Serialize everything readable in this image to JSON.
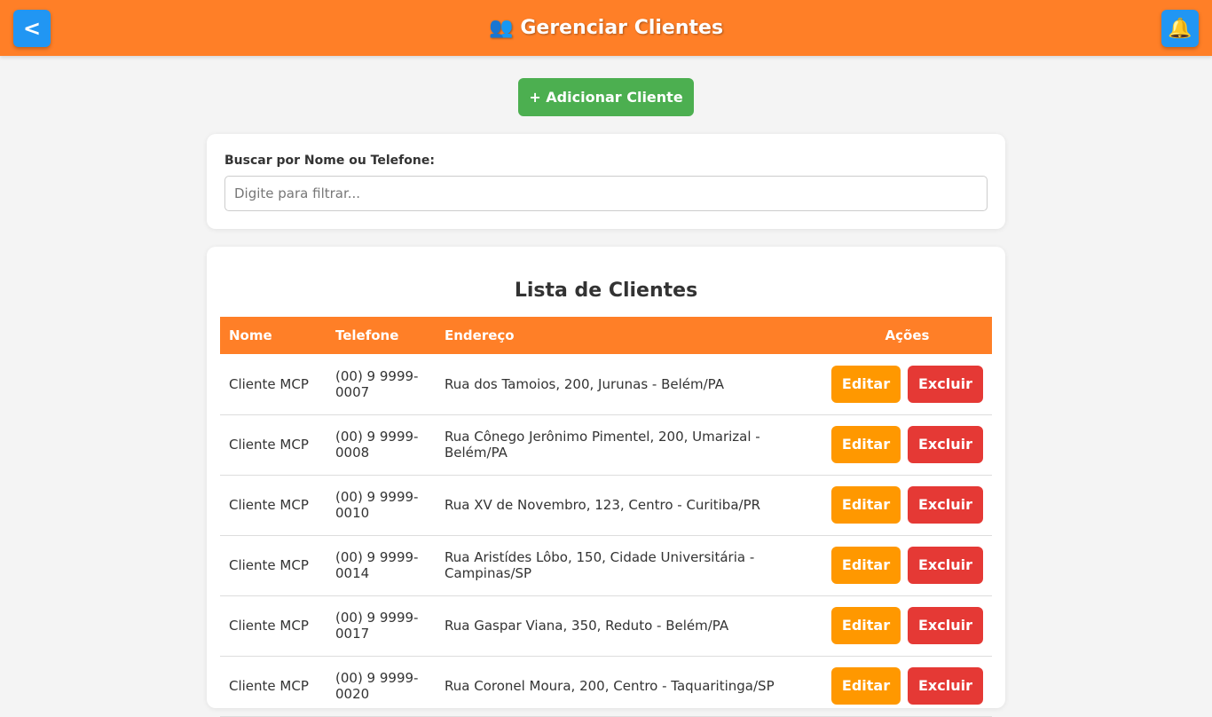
{
  "header": {
    "back_label": "<",
    "title_icon": "👥",
    "title": "Gerenciar Clientes",
    "bell_icon": "🔔",
    "color": "#ff7f27"
  },
  "add_button": {
    "label": "+ Adicionar Cliente",
    "color": "#4caf50"
  },
  "search": {
    "label": "Buscar por Nome ou Telefone:",
    "placeholder": "Digite para filtrar...",
    "value": ""
  },
  "list": {
    "title": "Lista de Clientes",
    "columns": [
      "Nome",
      "Telefone",
      "Endereço",
      "Ações"
    ],
    "edit_label": "Editar",
    "delete_label": "Excluir",
    "rows": [
      {
        "name": "Cliente MCP",
        "phone": "(00) 9 9999-0007",
        "address": "Rua dos Tamoios, 200, Jurunas - Belém/PA"
      },
      {
        "name": "Cliente MCP",
        "phone": "(00) 9 9999-0008",
        "address": "Rua Cônego Jerônimo Pimentel, 200, Umarizal - Belém/PA"
      },
      {
        "name": "Cliente MCP",
        "phone": "(00) 9 9999-0010",
        "address": "Rua XV de Novembro, 123, Centro - Curitiba/PR"
      },
      {
        "name": "Cliente MCP",
        "phone": "(00) 9 9999-0014",
        "address": "Rua Aristídes Lôbo, 150, Cidade Universitária - Campinas/SP"
      },
      {
        "name": "Cliente MCP",
        "phone": "(00) 9 9999-0017",
        "address": "Rua Gaspar Viana, 350, Reduto - Belém/PA"
      },
      {
        "name": "Cliente MCP",
        "phone": "(00) 9 9999-0020",
        "address": "Rua Coronel Moura, 200, Centro - Taquaritinga/SP"
      }
    ]
  },
  "colors": {
    "edit": "#ff9800",
    "delete": "#e53935",
    "back": "#2196f3"
  }
}
